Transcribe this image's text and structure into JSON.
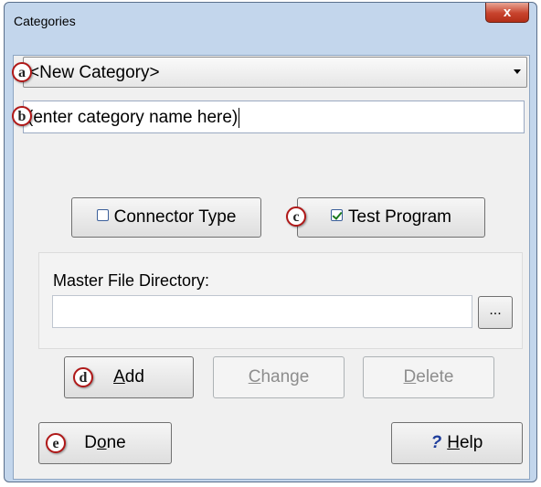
{
  "window": {
    "title": "Categories",
    "close_label": "x"
  },
  "markers": {
    "a": "a",
    "b": "b",
    "c": "c",
    "d": "d",
    "e": "e"
  },
  "category_select": {
    "value": "<New Category>"
  },
  "category_name": {
    "value": "(enter category name here)"
  },
  "toggles": {
    "connector_type": {
      "label": "Connector Type",
      "checked": false
    },
    "test_program": {
      "label": "Test Program",
      "checked": true
    }
  },
  "master_dir": {
    "label": "Master File Directory:",
    "value": "",
    "browse_label": "..."
  },
  "actions": {
    "add": {
      "label": "Add",
      "mnemonic": "A",
      "rest": "dd"
    },
    "change": {
      "label": "Change",
      "mnemonic": "C",
      "rest": "hange"
    },
    "delete": {
      "label": "Delete",
      "mnemonic": "D",
      "rest": "elete"
    }
  },
  "footer": {
    "done": {
      "label": "Done",
      "pre": "D",
      "mnemonic": "o",
      "rest": "ne"
    },
    "help": {
      "label": "Help",
      "icon": "?",
      "mnemonic": "H",
      "rest": "elp"
    }
  }
}
